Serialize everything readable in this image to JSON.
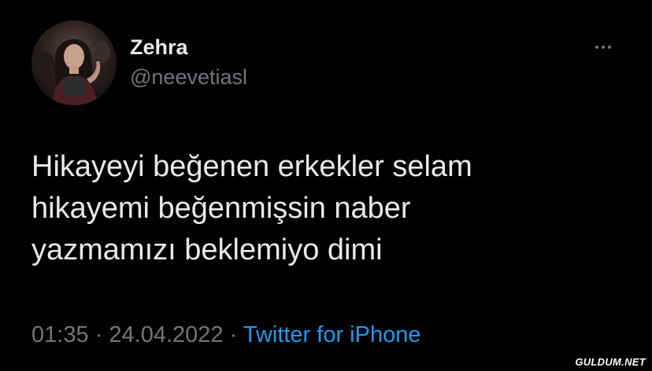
{
  "tweet": {
    "author": {
      "display_name": "Zehra",
      "handle": "@neevetiasl"
    },
    "more_icon": "more-horizontal-icon",
    "text_lines": [
      "Hikayeyi beğenen erkekler selam",
      "hikayemi beğenmişsin naber",
      "yazmamızı beklemiyo dimi"
    ],
    "time": "01:35",
    "separator": "·",
    "date": "24.04.2022",
    "source": "Twitter for iPhone"
  },
  "watermark": "GULDUM.NET",
  "colors": {
    "background": "#000000",
    "text_primary": "#e7e9ea",
    "text_secondary": "#71767b",
    "link": "#1d9bf0"
  }
}
